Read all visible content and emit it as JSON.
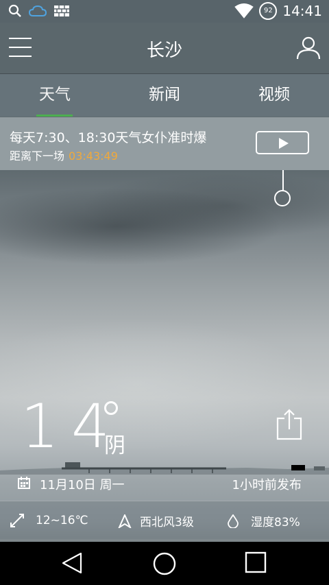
{
  "status_bar": {
    "time": "14:41",
    "battery": "92",
    "icons": [
      "search-icon",
      "cloud-icon",
      "brick-icon",
      "wifi-icon",
      "battery-icon"
    ]
  },
  "header": {
    "city": "长沙",
    "menu_icon": "menu-icon",
    "user_icon": "user-icon"
  },
  "tabs": [
    {
      "label": "天气",
      "active": true
    },
    {
      "label": "新闻",
      "active": false
    },
    {
      "label": "视频",
      "active": false
    }
  ],
  "broadcast": {
    "title": "每天7:30、18:30天气女仆准时爆",
    "countdown_label": "距离下一场",
    "countdown_value": "03:43:49",
    "countdown_color": "#f1a93a"
  },
  "weather": {
    "temperature": "14",
    "condition": "阴",
    "date": "11月10日 周一",
    "published": "1小时前发布",
    "range": "12~16℃",
    "wind": "西北风3级",
    "humidity": "湿度83%"
  },
  "colors": {
    "active_tab_indicator": "#4caf50",
    "status_bar": "#58646a"
  }
}
